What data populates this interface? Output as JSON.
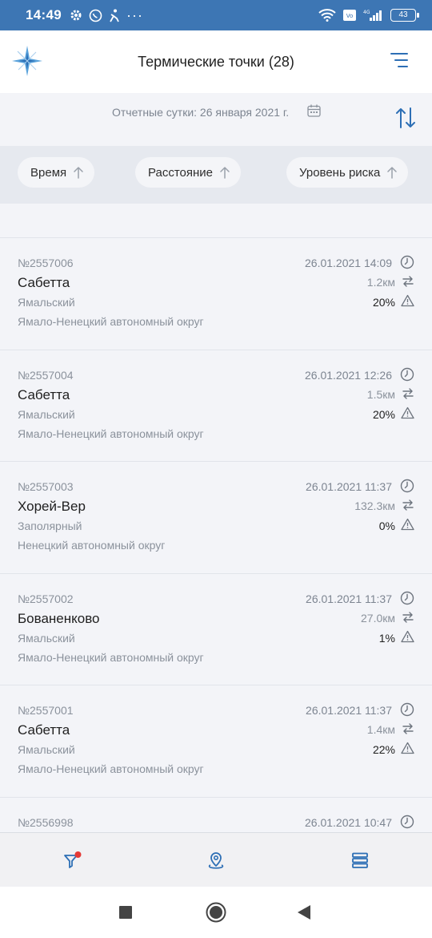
{
  "status": {
    "time": "14:49",
    "battery": "43"
  },
  "header": {
    "title": "Термические точки (28)"
  },
  "date_bar": {
    "text": "Отчетные сутки: 26 января 2021 г."
  },
  "filters": [
    {
      "label": "Время"
    },
    {
      "label": "Расстояние"
    },
    {
      "label": "Уровень риска"
    }
  ],
  "records": [
    {
      "num": "№2557006",
      "place": "Сабетта",
      "district": "Ямальский",
      "region": "Ямало-Ненецкий автономный округ",
      "date": "26.01.2021 14:09",
      "distance": "1.2км",
      "risk": "20%"
    },
    {
      "num": "№2557004",
      "place": "Сабетта",
      "district": "Ямальский",
      "region": "Ямало-Ненецкий автономный округ",
      "date": "26.01.2021 12:26",
      "distance": "1.5км",
      "risk": "20%"
    },
    {
      "num": "№2557003",
      "place": "Хорей-Вер",
      "district": "Заполярный",
      "region": "Ненецкий автономный округ",
      "date": "26.01.2021 11:37",
      "distance": "132.3км",
      "risk": "0%"
    },
    {
      "num": "№2557002",
      "place": "Бованенково",
      "district": "Ямальский",
      "region": "Ямало-Ненецкий автономный округ",
      "date": "26.01.2021 11:37",
      "distance": "27.0км",
      "risk": "1%"
    },
    {
      "num": "№2557001",
      "place": "Сабетта",
      "district": "Ямальский",
      "region": "Ямало-Ненецкий автономный округ",
      "date": "26.01.2021 11:37",
      "distance": "1.4км",
      "risk": "22%"
    },
    {
      "num": "№2556998",
      "place": "",
      "district": "",
      "region": "",
      "date": "26.01.2021 10:47",
      "distance": "",
      "risk": ""
    }
  ],
  "colors": {
    "status_bar": "#3d76b4",
    "accent": "#2d6fb5",
    "badge": "#e53935"
  },
  "icons": {
    "filter": "filter-icon",
    "map": "map-pin-icon",
    "list": "list-icon"
  }
}
